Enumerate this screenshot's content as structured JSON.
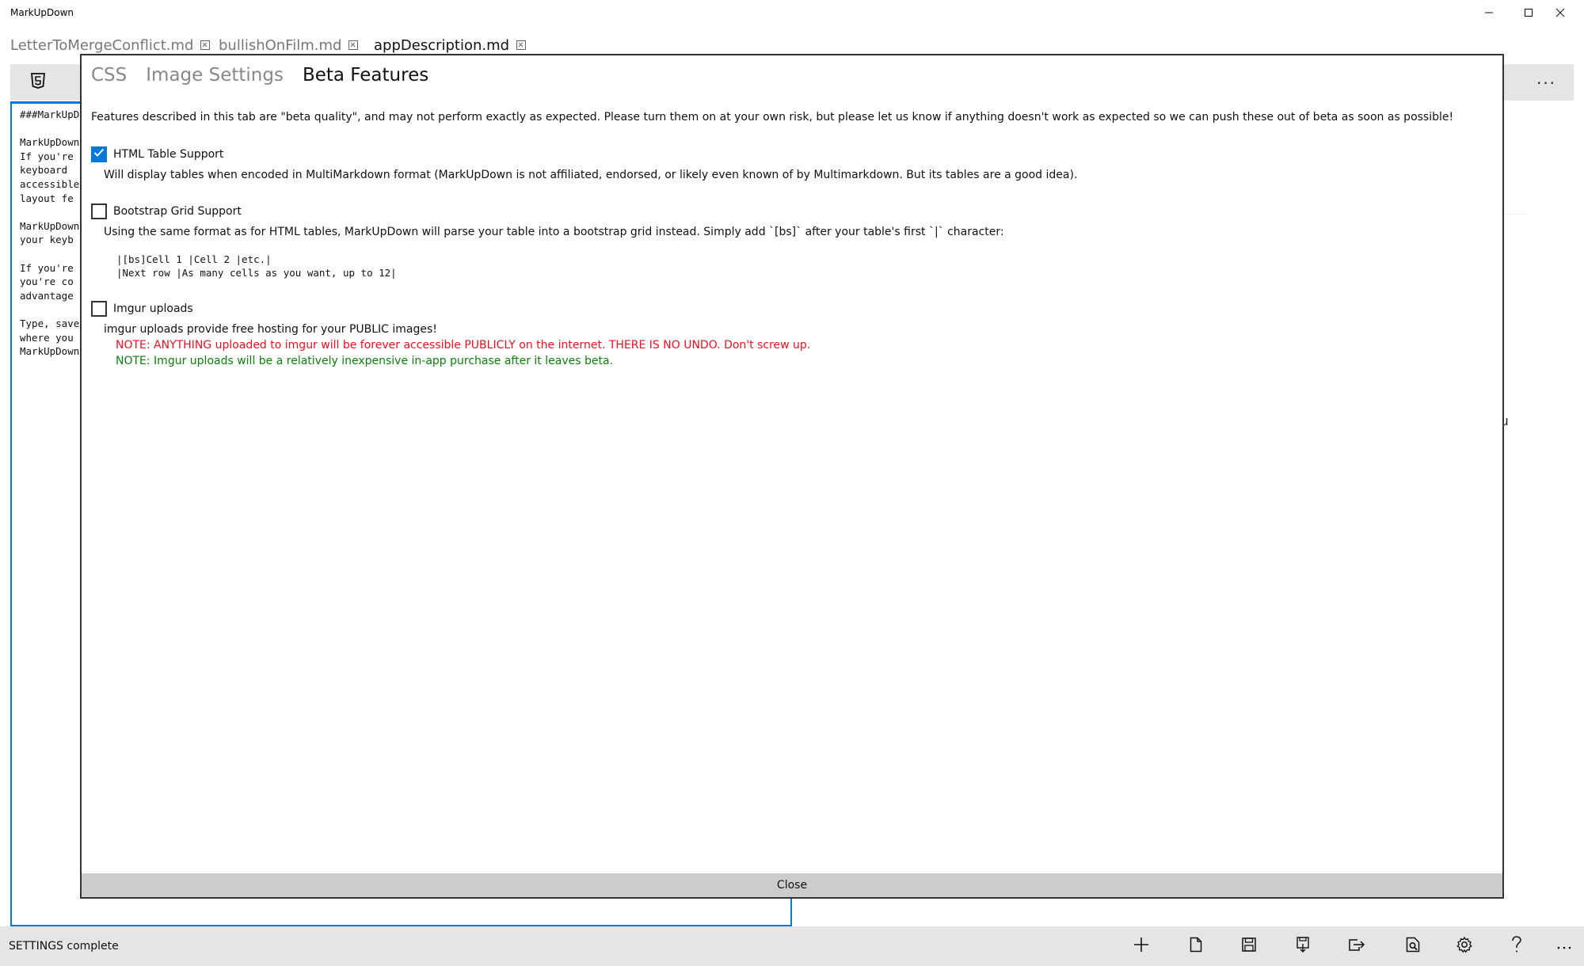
{
  "window": {
    "title": "MarkUpDown",
    "minimize_icon": "minimize-icon",
    "maximize_icon": "maximize-icon",
    "close_icon": "close-icon"
  },
  "document_tabs": [
    {
      "label": "LetterToMergeConflict.md",
      "active": false
    },
    {
      "label": "bullishOnFilm.md",
      "active": false
    },
    {
      "label": "appDescription.md",
      "active": true
    }
  ],
  "toolbar": {
    "html5_icon": "html5-icon",
    "more_label": "···"
  },
  "editor": {
    "lines": [
      "###MarkUpDown",
      "",
      "MarkUpDown",
      "If you're",
      "keyboard",
      "accessible",
      "layout fe",
      "",
      "MarkUpDown",
      "your keyb",
      "",
      "If you're",
      "you're co",
      "advantage",
      "",
      "Type, save",
      "where you",
      "MarkUpDown"
    ]
  },
  "preview": {
    "fragment": "u"
  },
  "settings_dialog": {
    "tabs": [
      {
        "label": "CSS",
        "active": false
      },
      {
        "label": "Image Settings",
        "active": false
      },
      {
        "label": "Beta Features",
        "active": true
      }
    ],
    "intro": "Features described in this tab are \"beta quality\", and may not perform exactly as expected. Please turn them on at your own risk, but please let us know if anything doesn't work as expected so we can push these out of beta as soon as possible!",
    "features": {
      "html_table": {
        "label": "HTML Table Support",
        "checked": true,
        "description": "Will display tables when encoded in MultiMarkdown format (MarkUpDown is not affiliated, endorsed, or likely even known of by Multimarkdown. But its tables are a good idea)."
      },
      "bootstrap_grid": {
        "label": "Bootstrap Grid Support",
        "checked": false,
        "description": "Using the same format as for HTML tables, MarkUpDown will parse your table into a bootstrap grid instead. Simply add `[bs]` after your table's first `|` character:",
        "code": [
          "|[bs]Cell 1 |Cell 2 |etc.|",
          "|Next row |As many cells as you want, up to 12|"
        ]
      },
      "imgur": {
        "label": "Imgur uploads",
        "checked": false,
        "description": "imgur uploads provide free hosting for your PUBLIC images!",
        "note_warning": "NOTE: ANYTHING uploaded to imgur will be forever accessible PUBLICLY on the internet. THERE IS NO UNDO. Don't screw up.",
        "note_pricing": "NOTE: Imgur uploads will be a relatively inexpensive in-app purchase after it leaves beta."
      }
    },
    "close_label": "Close"
  },
  "statusbar": {
    "text": "SETTINGS complete",
    "buttons": [
      "add-icon",
      "new-file-icon",
      "save-icon",
      "save-as-icon",
      "export-icon",
      "preview-search-icon",
      "settings-gear-icon",
      "help-icon",
      "more-icon"
    ]
  },
  "colors": {
    "accent": "#0078d7",
    "warning": "#e81123",
    "success": "#107c10",
    "toolbar_bg": "#e5e5e5",
    "close_bar_bg": "#cccccc"
  }
}
